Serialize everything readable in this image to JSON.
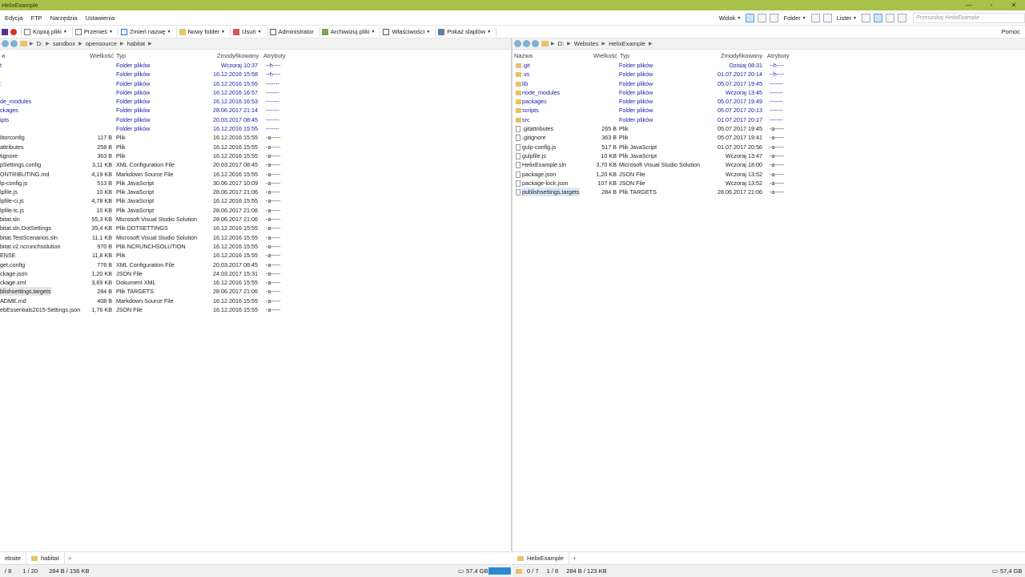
{
  "window": {
    "title": "HelixExample",
    "min": "—",
    "max": "▫",
    "close": "✕"
  },
  "menu": [
    "Edycja",
    "FTP",
    "Narzędzia",
    "Ustawienia"
  ],
  "menu_right": {
    "widok": "Widok",
    "folder": "Folder",
    "lister": "Lister",
    "search_placeholder": "Przeszukaj HelixExample",
    "pomoc": "Pomoc"
  },
  "toolbar": [
    "Kopiuj pliki",
    "Przenieś",
    "Zmień nazwę",
    "Nowy folder",
    "Usuń",
    "Administrator",
    "Archiwizuj pliki",
    "Właściwości",
    "Pokaż slajdów"
  ],
  "left": {
    "path": [
      "D:",
      "sandbox",
      "opensource",
      "habitat"
    ],
    "headers": {
      "name": "a",
      "size": "Wielkość",
      "type": "Typ",
      "date": "Zmodyfikowany",
      "attr": "Atrybuty"
    },
    "rows": [
      {
        "n": "t",
        "s": "",
        "t": "Folder plików",
        "d": "Wczoraj  10:37",
        "a": "--h----",
        "f": true
      },
      {
        "n": "",
        "s": "",
        "t": "Folder plików",
        "d": "16.12.2016  15:58",
        "a": "--h----",
        "f": true
      },
      {
        "n": ":",
        "s": "",
        "t": "Folder plików",
        "d": "16.12.2016  15:55",
        "a": "-------",
        "f": true
      },
      {
        "n": "",
        "s": "",
        "t": "Folder plików",
        "d": "16.12.2016  16:57",
        "a": "-------",
        "f": true
      },
      {
        "n": "de_modules",
        "s": "",
        "t": "Folder plików",
        "d": "16.12.2016  16:53",
        "a": "-------",
        "f": true
      },
      {
        "n": "ckages",
        "s": "",
        "t": "Folder plików",
        "d": "28.06.2017  21:14",
        "a": "-------",
        "f": true
      },
      {
        "n": "ipts",
        "s": "",
        "t": "Folder plików",
        "d": "20.03.2017  08:45",
        "a": "-------",
        "f": true
      },
      {
        "n": "",
        "s": "",
        "t": "Folder plików",
        "d": "16.12.2016  15:55",
        "a": "-------",
        "f": true
      },
      {
        "n": "litorconfig",
        "s": "117 B",
        "t": "Plik",
        "d": "16.12.2016  15:55",
        "a": "-a-----",
        "f": false
      },
      {
        "n": "attributes",
        "s": "258 B",
        "t": "Plik",
        "d": "16.12.2016  15:55",
        "a": "-a-----",
        "f": false
      },
      {
        "n": "tignore",
        "s": "363 B",
        "t": "Plik",
        "d": "16.12.2016  15:55",
        "a": "-a-----",
        "f": false
      },
      {
        "n": "pSettings.config",
        "s": "3,11 KB",
        "t": "XML Configuration File",
        "d": "20.03.2017  08:45",
        "a": "-a-----",
        "f": false
      },
      {
        "n": "ONTRIBUTING.md",
        "s": "4,19 KB",
        "t": "Markdown Source File",
        "d": "16.12.2016  15:55",
        "a": "-a-----",
        "f": false
      },
      {
        "n": "lp-config.js",
        "s": "513 B",
        "t": "Plik JavaScript",
        "d": "30.06.2017  10:09",
        "a": "-a-----",
        "f": false
      },
      {
        "n": "lpfile.js",
        "s": "10 KB",
        "t": "Plik JavaScript",
        "d": "28.06.2017  21:06",
        "a": "-a-----",
        "f": false
      },
      {
        "n": "lpfile-ci.js",
        "s": "4,78 KB",
        "t": "Plik JavaScript",
        "d": "16.12.2016  15:55",
        "a": "-a-----",
        "f": false
      },
      {
        "n": "lpfile-tc.js",
        "s": "10 KB",
        "t": "Plik JavaScript",
        "d": "28.06.2017  21:06",
        "a": "-a-----",
        "f": false
      },
      {
        "n": "bitat.sln",
        "s": "55,3 KB",
        "t": "Microsoft Visual Studio Solution",
        "d": "28.06.2017  21:06",
        "a": "-a-----",
        "f": false
      },
      {
        "n": "bitat.sln.DotSettings",
        "s": "35,4 KB",
        "t": "Plik DOTSETTINGS",
        "d": "16.12.2016  15:55",
        "a": "-a-----",
        "f": false
      },
      {
        "n": "bitat.TestScenarios.sln",
        "s": "11,1 KB",
        "t": "Microsoft Visual Studio Solution",
        "d": "16.12.2016  15:55",
        "a": "-a-----",
        "f": false
      },
      {
        "n": "bitat.v2.ncrunchsolution",
        "s": "970 B",
        "t": "Plik NCRUNCHSOLUTION",
        "d": "16.12.2016  15:55",
        "a": "-a-----",
        "f": false
      },
      {
        "n": "ENSE",
        "s": "11,8 KB",
        "t": "Plik",
        "d": "16.12.2016  15:55",
        "a": "-a-----",
        "f": false
      },
      {
        "n": "get.config",
        "s": "776 B",
        "t": "XML Configuration File",
        "d": "20.03.2017  08:45",
        "a": "-a-----",
        "f": false
      },
      {
        "n": "ckage.json",
        "s": "1,20 KB",
        "t": "JSON File",
        "d": "24.03.2017  15:31",
        "a": "-a-----",
        "f": false
      },
      {
        "n": "ckage.xml",
        "s": "3,69 KB",
        "t": "Dokument XML",
        "d": "16.12.2016  15:55",
        "a": "-a-----",
        "f": false
      },
      {
        "n": "blishsettings.targets",
        "s": "284 B",
        "t": "Plik TARGETS",
        "d": "28.06.2017  21:06",
        "a": "-a-----",
        "f": false,
        "hl": true
      },
      {
        "n": "ADME.md",
        "s": "408 B",
        "t": "Markdown Source File",
        "d": "16.12.2016  15:55",
        "a": "-a-----",
        "f": false
      },
      {
        "n": "ebEssentials2015-Settings.json",
        "s": "1,76 KB",
        "t": "JSON File",
        "d": "16.12.2016  15:55",
        "a": "-a-----",
        "f": false
      }
    ],
    "tabs": [
      "ebsite",
      "habitat"
    ],
    "status": {
      "count": "/ 8",
      "sel": "1 / 20",
      "size": "284 B / 156 KB",
      "disk": "57,4 GB"
    }
  },
  "right": {
    "path": [
      "D:",
      "Websites",
      "HelixExample"
    ],
    "headers": {
      "name": "Nazwa",
      "size": "Wielkość",
      "type": "Typ",
      "date": "Zmodyfikowany",
      "attr": "Atrybuty"
    },
    "rows": [
      {
        "n": ".git",
        "s": "",
        "t": "Folder plików",
        "d": "Dzisiaj  08:31",
        "a": "--h----",
        "f": true
      },
      {
        "n": ".vs",
        "s": "",
        "t": "Folder plików",
        "d": "01.07.2017  20:14",
        "a": "--h----",
        "f": true
      },
      {
        "n": "lib",
        "s": "",
        "t": "Folder plików",
        "d": "05.07.2017  19:45",
        "a": "-------",
        "f": true
      },
      {
        "n": "node_modules",
        "s": "",
        "t": "Folder plików",
        "d": "Wczoraj  13:45",
        "a": "-------",
        "f": true
      },
      {
        "n": "packages",
        "s": "",
        "t": "Folder plików",
        "d": "05.07.2017  19:49",
        "a": "-------",
        "f": true
      },
      {
        "n": "scripts",
        "s": "",
        "t": "Folder plików",
        "d": "05.07.2017  20:13",
        "a": "-------",
        "f": true
      },
      {
        "n": "src",
        "s": "",
        "t": "Folder plików",
        "d": "01.07.2017  20:17",
        "a": "-------",
        "f": true
      },
      {
        "n": ".gitattributes",
        "s": "265 B",
        "t": "Plik",
        "d": "05.07.2017  19:45",
        "a": "-a-----",
        "f": false
      },
      {
        "n": ".gitignore",
        "s": "363 B",
        "t": "Plik",
        "d": "05.07.2017  19:41",
        "a": "-a-----",
        "f": false
      },
      {
        "n": "gulp-config.js",
        "s": "517 B",
        "t": "Plik JavaScript",
        "d": "01.07.2017  20:56",
        "a": "-a-----",
        "f": false
      },
      {
        "n": "gulpfile.js",
        "s": "10 KB",
        "t": "Plik JavaScript",
        "d": "Wczoraj  13:47",
        "a": "-a-----",
        "f": false
      },
      {
        "n": "HelixExample.sln",
        "s": "3,70 KB",
        "t": "Microsoft Visual Studio Solution",
        "d": "Wczoraj  18:00",
        "a": "-a-----",
        "f": false
      },
      {
        "n": "package.json",
        "s": "1,20 KB",
        "t": "JSON File",
        "d": "Wczoraj  13:52",
        "a": "-a-----",
        "f": false
      },
      {
        "n": "package-lock.json",
        "s": "107 KB",
        "t": "JSON File",
        "d": "Wczoraj  13:52",
        "a": "-a-----",
        "f": false
      },
      {
        "n": "publishsettings.targets",
        "s": "284 B",
        "t": "Plik TARGETS",
        "d": "28.06.2017  21:06",
        "a": "-a-----",
        "f": false,
        "hl": true
      }
    ],
    "tabs": [
      "HelixExample"
    ],
    "status": {
      "count": "0 / 7",
      "sel": "1 / 8",
      "size": "284 B / 123 KB",
      "disk": "57,4 GB"
    }
  }
}
